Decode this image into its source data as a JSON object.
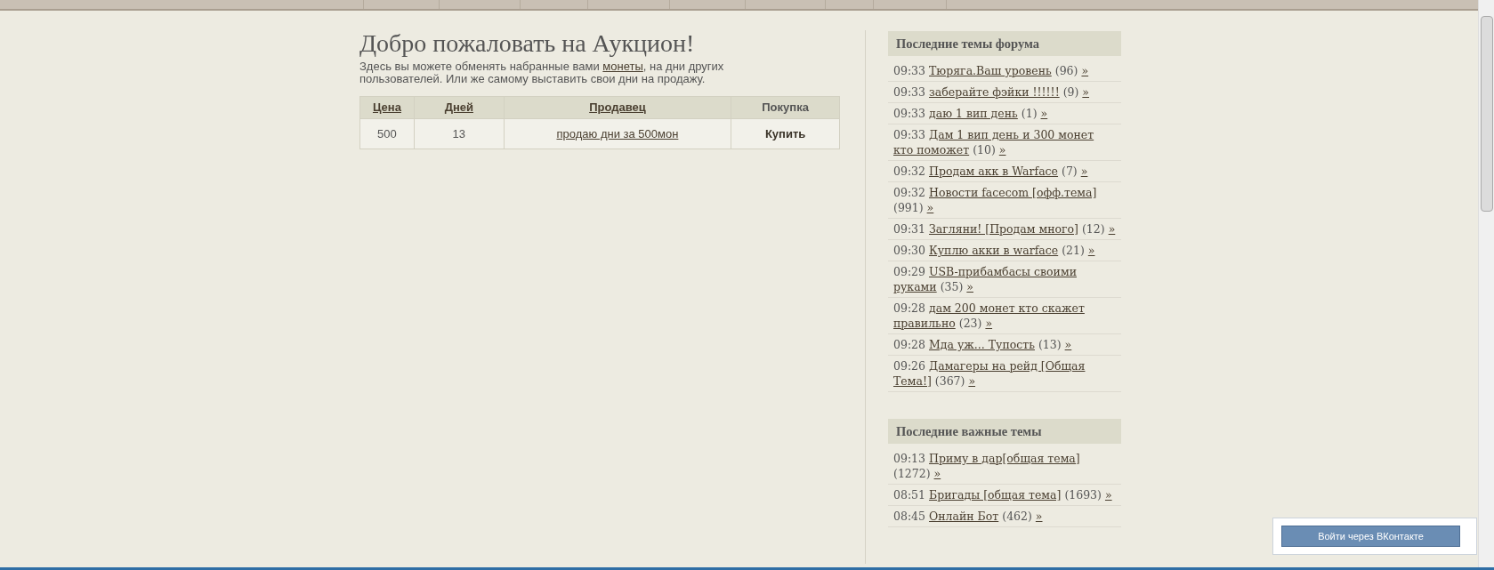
{
  "auction": {
    "title": "Добро пожаловать на Аукцион!",
    "intro": "Здесь вы можете обменять набранные вами ",
    "intro_link": "монеты",
    "intro_rest": ", на дни других пользователей. Или же самому выставить свои дни на продажу.",
    "columns": [
      {
        "label": "Цена",
        "link": true
      },
      {
        "label": "Дней",
        "link": true
      },
      {
        "label": "Продавец",
        "link": true
      },
      {
        "label": "Покупка",
        "link": false
      }
    ],
    "rows": [
      {
        "price": "500",
        "days": "13",
        "seller": "продаю дни за 500мон",
        "action": "Купить"
      }
    ]
  },
  "sidebar": [
    {
      "title": "Последние темы форума",
      "topics": [
        {
          "time": "09:33",
          "title": "Тюряга.Ваш уровень",
          "count": "(96)",
          "more": "»"
        },
        {
          "time": "09:33",
          "title": "заберайте фэйки !!!!!!",
          "count": "(9)",
          "more": "»"
        },
        {
          "time": "09:33",
          "title": "даю 1 вип день",
          "count": "(1)",
          "more": "»"
        },
        {
          "time": "09:33",
          "title": "Дам 1 вип день и 300 монет кто поможет",
          "count": "(10)",
          "more": "»"
        },
        {
          "time": "09:32",
          "title": "Продам акк в Warface",
          "count": "(7)",
          "more": "»"
        },
        {
          "time": "09:32",
          "title": "Новости facecom [офф.тема]",
          "count": "(991)",
          "more": "»"
        },
        {
          "time": "09:31",
          "title": "Загляни! [Продам много]",
          "count": "(12)",
          "more": "»"
        },
        {
          "time": "09:30",
          "title": "Куплю акки в warface",
          "count": "(21)",
          "more": "»"
        },
        {
          "time": "09:29",
          "title": "USB-прибамбасы своими руками",
          "count": "(35)",
          "more": "»"
        },
        {
          "time": "09:28",
          "title": "дам 200 монет кто скажет правильно",
          "count": "(23)",
          "more": "»"
        },
        {
          "time": "09:28",
          "title": "Мда уж... Тупость",
          "count": "(13)",
          "more": "»"
        },
        {
          "time": "09:26",
          "title": "Дамагеры на рейд [Общая Тема!]",
          "count": "(367)",
          "more": "»"
        }
      ]
    },
    {
      "title": "Последние важные темы",
      "topics": [
        {
          "time": "09:13",
          "title": "Приму в дар[общая тема]",
          "count": "(1272)",
          "more": "»"
        },
        {
          "time": "08:51",
          "title": "Бригады [общая тема]",
          "count": "(1693)",
          "more": "»"
        },
        {
          "time": "08:45",
          "title": "Онлайн Бот",
          "count": "(462)",
          "more": "»"
        }
      ]
    }
  ],
  "login_button": "Войти через ВКонтакте"
}
